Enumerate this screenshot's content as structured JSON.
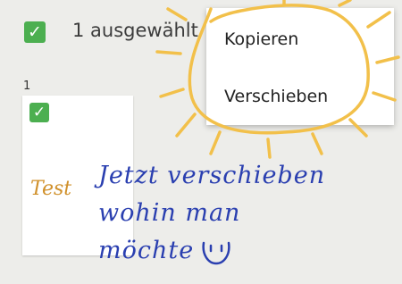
{
  "header": {
    "selected_label": "1 ausgewählt"
  },
  "context_menu": {
    "items": [
      {
        "label": "Kopieren"
      },
      {
        "label": "Verschieben"
      }
    ]
  },
  "pages": [
    {
      "number": "1",
      "thumbnail_text": "Test",
      "selected": true
    }
  ],
  "annotation": {
    "lines": [
      "Jetzt verschieben",
      "wohin man",
      "möchte"
    ]
  },
  "colors": {
    "checkbox": "#4caf50",
    "sun_highlight": "#f2c04a",
    "handwriting": "#2a3fb0",
    "thumbnail_text": "#d0902a",
    "background": "#ededea"
  },
  "icons": {
    "checkbox": "check-icon",
    "smiley": "smiley-icon"
  }
}
